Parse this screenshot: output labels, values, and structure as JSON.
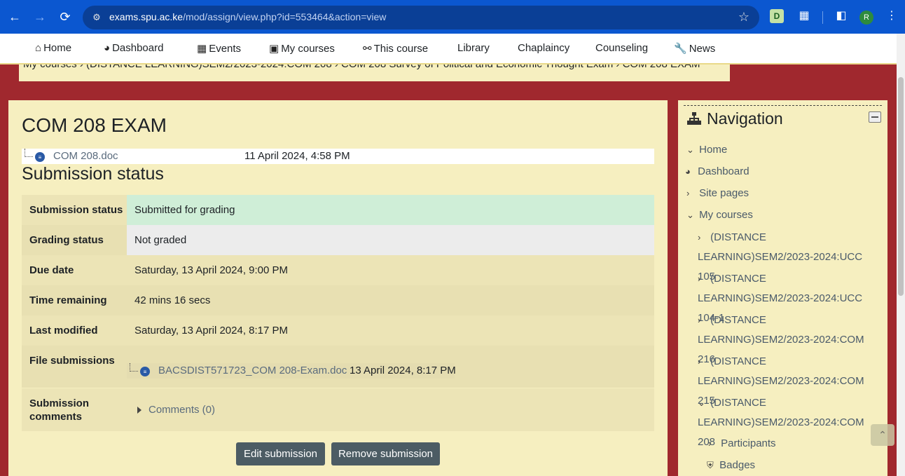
{
  "browser": {
    "url_host": "exams.spu.ac.ke",
    "url_path": "/mod/assign/view.php?id=553464&action=view",
    "avatar_letter": "R"
  },
  "navbar": {
    "items": [
      {
        "label": "Home",
        "icon": "home-icon"
      },
      {
        "label": "Dashboard",
        "icon": "dashboard-icon"
      },
      {
        "label": "Events",
        "icon": "calendar-icon"
      },
      {
        "label": "My courses",
        "icon": "briefcase-icon"
      },
      {
        "label": "This course",
        "icon": "sitemap-icon"
      },
      {
        "label": "Library"
      },
      {
        "label": "Chaplaincy"
      },
      {
        "label": "Counseling"
      },
      {
        "label": "News",
        "icon": "wrench-icon"
      }
    ]
  },
  "breadcrumb": {
    "text": "My courses  ›  (DISTANCE LEARNING)SEM2/2023-2024:COM 208  ›  COM 208 Survey of Political and Economic Thought Exam  ›  COM 208 EXAM"
  },
  "main": {
    "title": "COM 208 EXAM",
    "intro_file": {
      "name": "COM 208.doc",
      "date": "11 April 2024, 4:58 PM"
    },
    "section_title": "Submission status",
    "rows": {
      "submission_status": {
        "label": "Submission status",
        "value": "Submitted for grading"
      },
      "grading_status": {
        "label": "Grading status",
        "value": "Not graded"
      },
      "due_date": {
        "label": "Due date",
        "value": "Saturday, 13 April 2024, 9:00 PM"
      },
      "time_remaining": {
        "label": "Time remaining",
        "value": "42 mins 16 secs"
      },
      "last_modified": {
        "label": "Last modified",
        "value": "Saturday, 13 April 2024, 8:17 PM"
      },
      "file_submissions": {
        "label": "File submissions",
        "file_name": "BACSDIST571723_COM 208-Exam.doc",
        "file_date": "13 April 2024, 8:17 PM"
      },
      "submission_comments": {
        "label_line1": "Submission",
        "label_line2": "comments",
        "comments": "Comments (0)"
      }
    },
    "buttons": {
      "edit": "Edit submission",
      "remove": "Remove submission"
    }
  },
  "navigation": {
    "title": "Navigation",
    "home": "Home",
    "dashboard": "Dashboard",
    "site_pages": "Site pages",
    "my_courses": "My courses",
    "courses": [
      "(DISTANCE LEARNING)SEM2/2023-2024:UCC 105",
      "(DISTANCE LEARNING)SEM2/2023-2024:UCC 104-1",
      "(DISTANCE LEARNING)SEM2/2023-2024:COM 216",
      "(DISTANCE LEARNING)SEM2/2023-2024:COM 215",
      "(DISTANCE LEARNING)SEM2/2023-2024:COM 208"
    ],
    "participants": "Participants",
    "badges": "Badges"
  },
  "colors": {
    "browser_bar": "#0b57d0",
    "page_background": "#a0282e",
    "card_background": "#f6efc0",
    "submitted_green": "#cfeed7",
    "button": "#4c5c64"
  }
}
